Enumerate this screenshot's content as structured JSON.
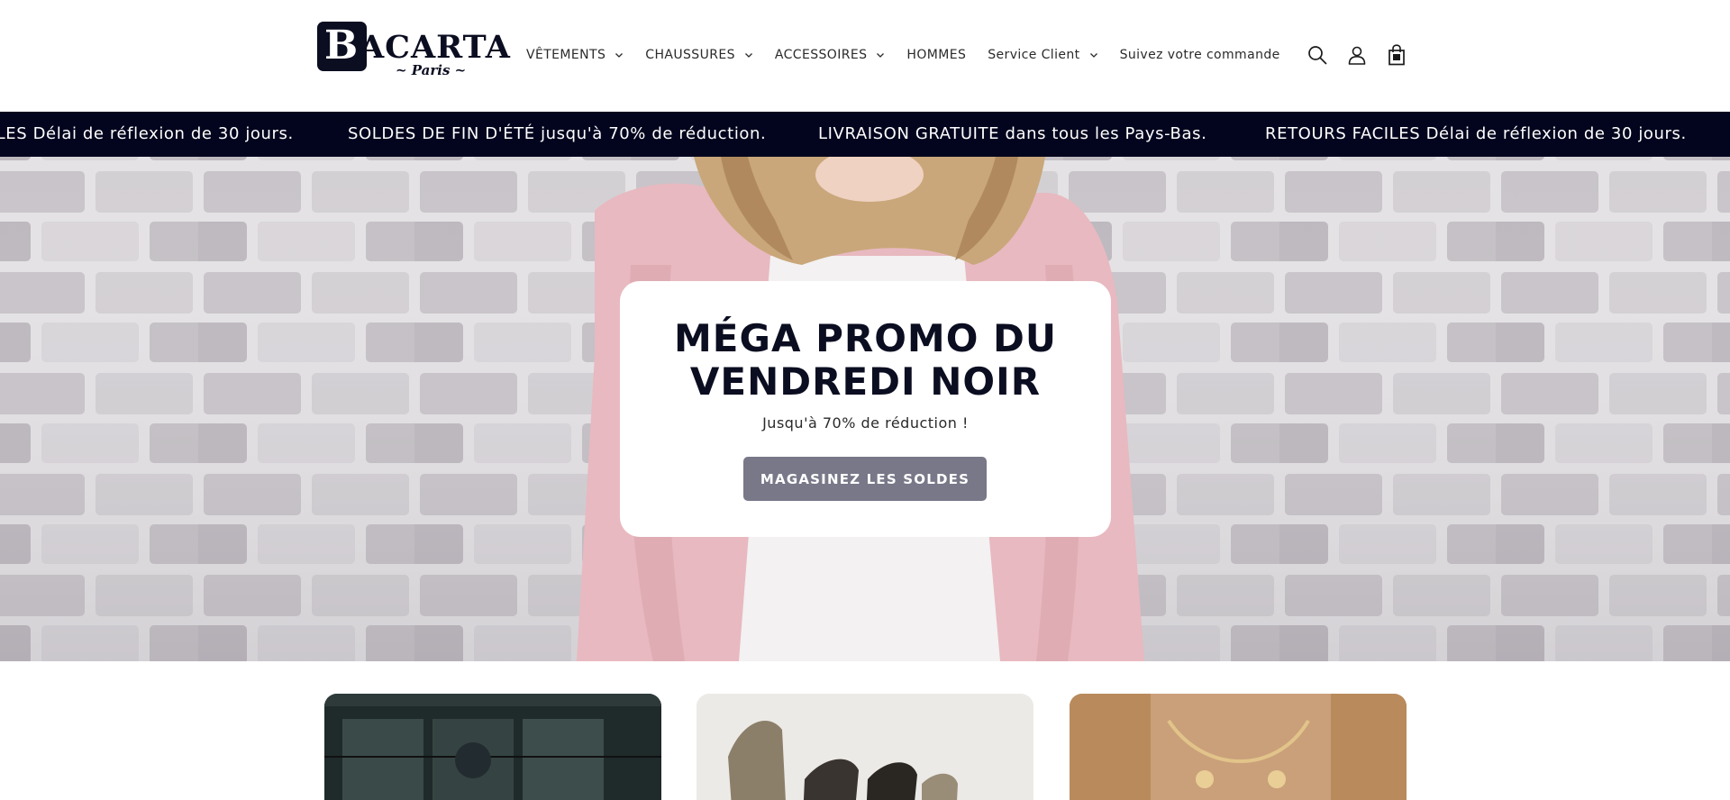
{
  "brand": {
    "logo_initial": "B",
    "logo_rest": "ACARTA",
    "logo_sub": "~ Paris ~",
    "color_dark": "#0b0d21"
  },
  "nav": {
    "items": [
      {
        "label": "VÊTEMENTS",
        "has_dropdown": true
      },
      {
        "label": "CHAUSSURES",
        "has_dropdown": true
      },
      {
        "label": "ACCESSOIRES",
        "has_dropdown": true
      },
      {
        "label": "HOMMES",
        "has_dropdown": false
      },
      {
        "label": "Service Client",
        "has_dropdown": true
      },
      {
        "label": "Suivez votre commande",
        "has_dropdown": false
      }
    ]
  },
  "header_icons": [
    "search-icon",
    "account-icon",
    "cart-icon"
  ],
  "announcement": {
    "background": "#03051e",
    "items": [
      "RETOURS FACILES Délai de réflexion de 30 jours.",
      "SOLDES DE FIN D'ÉTÉ jusqu'à 70% de réduction.",
      "LIVRAISON GRATUITE dans tous les Pays-Bas.",
      "RETOURS FACILES Délai de réflexion de 30 jours."
    ]
  },
  "hero": {
    "title_line1": "MÉGA PROMO DU",
    "title_line2": "VENDREDI NOIR",
    "subtitle": "Jusqu'à 70% de réduction !",
    "button_label": "MAGASINEZ LES SOLDES",
    "button_color": "#787889"
  },
  "category_cards": [
    {
      "name": "clothing-card"
    },
    {
      "name": "shoes-card"
    },
    {
      "name": "accessories-card"
    }
  ]
}
